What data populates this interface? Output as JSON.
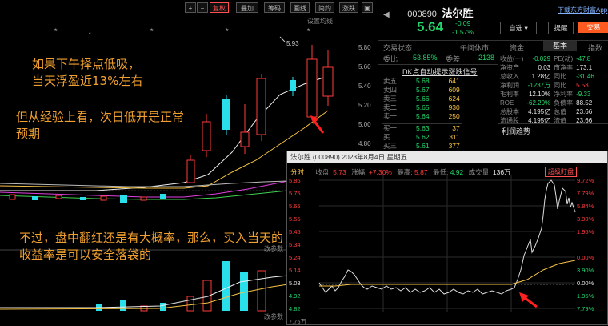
{
  "kline": {
    "toolbar": {
      "plus": "+",
      "minus": "−",
      "fuquan": "复权",
      "diejia": "叠加",
      "choumа": "筹码",
      "huaxian": "画线",
      "jianyue": "简约",
      "zhangdie": "涨跌"
    },
    "setting_label": "设置均线",
    "high_marker": "5.93",
    "yaxis": [
      "5.80",
      "5.60",
      "5.40",
      "5.20",
      "5.00",
      "4.80"
    ],
    "volume_label": "改参数",
    "volume_label2": "改参数",
    "annotations": {
      "a1_line1": "如果下午择点低吸，",
      "a1_line2": "当天浮盈近13%左右",
      "a2_line1": "但从经验上看，次日低开是正常",
      "a2_line2": "预期",
      "a3_line1": "不过，盘中翻红还是有大概率，那么，买入当天的",
      "a3_line2": "收益率是可以安全落袋的"
    },
    "colors": {
      "up": "#ff3b3b",
      "down": "#29e0ea",
      "ma1": "#ffffff",
      "ma2": "#f5c244",
      "ma3": "#e040e0",
      "ma4": "#3fd04f"
    }
  },
  "quote": {
    "code": "000890",
    "name": "法尔胜",
    "price": "5.64",
    "change": "-0.09",
    "pct": "-1.57%",
    "status_label": "交易状态",
    "status_value": "午间休市",
    "weibi_label": "委比",
    "weibi_value": "-53.85%",
    "weicha_label": "委差",
    "weicha_value": "-2138",
    "dk_label": "DK点自动提示涨跌信号",
    "asks": [
      {
        "l": "卖五",
        "p": "5.68",
        "v": "641"
      },
      {
        "l": "卖四",
        "p": "5.67",
        "v": "609"
      },
      {
        "l": "卖三",
        "p": "5.66",
        "v": "624"
      },
      {
        "l": "卖二",
        "p": "5.65",
        "v": "930"
      },
      {
        "l": "卖一",
        "p": "5.64",
        "v": "250"
      }
    ],
    "bids": [
      {
        "l": "买一",
        "p": "5.63",
        "v": "37"
      },
      {
        "l": "买二",
        "p": "5.62",
        "v": "311"
      },
      {
        "l": "买三",
        "p": "5.61",
        "v": "377"
      }
    ]
  },
  "right": {
    "download_link": "下载东方财富App",
    "zixuan": "自选",
    "tixing": "提醒",
    "trade": "交易",
    "tabs": [
      "资金",
      "基本",
      "指数"
    ],
    "rows": [
      {
        "l": "收益(一)",
        "v": "-0.029",
        "l2": "PE(动)",
        "v2": "-47.8"
      },
      {
        "l": "净资产",
        "v": "0.03",
        "l2": "市净率",
        "v2": "173.1"
      },
      {
        "l": "总收入",
        "v": "1.28亿",
        "l2": "同比",
        "v2": "-31.46"
      },
      {
        "l": "净利润",
        "v": "-1237万",
        "l2": "同比",
        "v2": "5.53"
      },
      {
        "l": "毛利率",
        "v": "12.10%",
        "l2": "净利率",
        "v2": "-9.33"
      },
      {
        "l": "ROE",
        "v": "-62.29%",
        "l2": "负债率",
        "v2": "88.52"
      },
      {
        "l": "总股本",
        "v": "4.195亿",
        "l2": "总值",
        "v2": "23.66"
      },
      {
        "l": "流通股",
        "v": "4.195亿",
        "l2": "流值",
        "v2": "23.66"
      }
    ],
    "trend_label": "利润趋势"
  },
  "intraday": {
    "title": "法尔胜 (000890) 2023年8月4日 星期五",
    "fenshi": "分时",
    "shoupan_label": "收盘",
    "shoupan": "5.73",
    "zhangfu_label": "涨幅",
    "zhangfu": "+7.30%",
    "zuigao_label": "最高",
    "zuigao": "5.87",
    "zuidi_label": "最低",
    "zuidi": "4.92",
    "liang_label": "成交量",
    "liang": "136万",
    "badge": "超级盯盘",
    "yaxis_left": [
      "5.86",
      "5.75",
      "5.65",
      "5.55",
      "5.45",
      "5.34",
      "5.24",
      "5.14",
      "5.03",
      "4.92",
      "4.82",
      "7.75万"
    ],
    "yaxis_right": [
      "9.72%",
      "7.79%",
      "5.84%",
      "3.90%",
      "1.95%",
      "0.00%",
      "1.95%",
      "3.90%",
      "5.84%",
      "7.79%",
      "9.72%"
    ]
  }
}
